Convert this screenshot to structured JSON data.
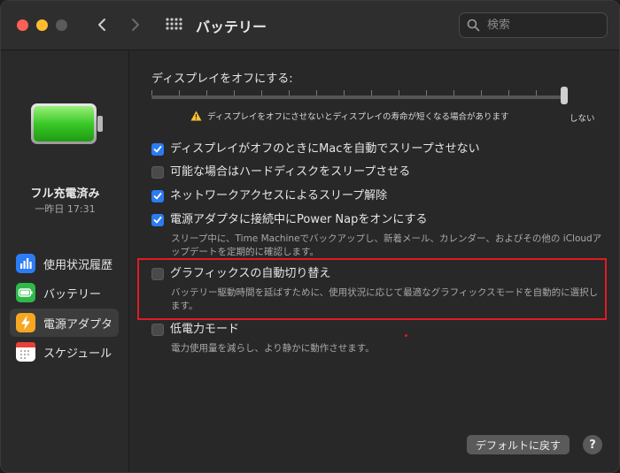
{
  "window": {
    "title": "バッテリー",
    "search_placeholder": "検索"
  },
  "sidebar": {
    "charge_status": "フル充電済み",
    "charge_time": "一昨日 17:31",
    "items": [
      {
        "label": "使用状況履歴",
        "icon": "bar-chart-icon",
        "color": "#2d7cf6",
        "active": false
      },
      {
        "label": "バッテリー",
        "icon": "battery-icon",
        "color": "#30b94a",
        "active": false
      },
      {
        "label": "電源アダプタ",
        "icon": "bolt-icon",
        "color": "#f5a623",
        "active": true
      },
      {
        "label": "スケジュール",
        "icon": "calendar-icon",
        "color": "#ffffff",
        "active": false
      }
    ]
  },
  "main": {
    "display_off_label": "ディスプレイをオフにする:",
    "warning_text": "ディスプレイをオフにさせないとディスプレイの寿命が短くなる場合があります",
    "never_label": "しない",
    "slider_value": "しない",
    "options": [
      {
        "label": "ディスプレイがオフのときにMacを自動でスリープさせない",
        "checked": true
      },
      {
        "label": "可能な場合はハードディスクをスリープさせる",
        "checked": false
      },
      {
        "label": "ネットワークアクセスによるスリープ解除",
        "checked": true
      },
      {
        "label": "電源アダプタに接続中にPower Napをオンにする",
        "checked": true,
        "desc": "スリープ中に、Time Machineでバックアップし、新着メール、カレンダー、およびその他の iCloudアップデートを定期的に確認します。"
      },
      {
        "label": "グラフィックスの自動切り替え",
        "checked": false,
        "desc": "バッテリー駆動時間を延ばすために、使用状況に応じて最適なグラフィックスモードを自動的に選択します。"
      },
      {
        "label": "低電力モード",
        "checked": false,
        "desc": "電力使用量を減らし、より静かに動作させます。"
      }
    ]
  },
  "footer": {
    "default_button": "デフォルトに戻す",
    "help_button": "?"
  },
  "colors": {
    "accent": "#2c7bf2",
    "highlight_box": "#e01b24",
    "battery_green": "#4cd137"
  }
}
